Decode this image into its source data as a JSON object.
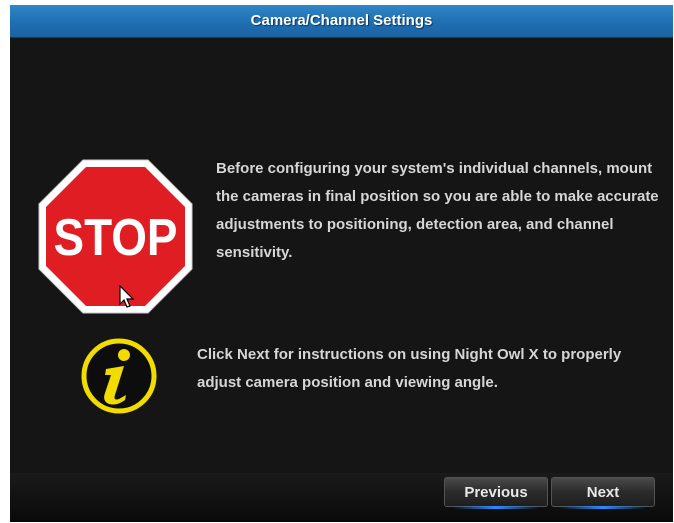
{
  "window": {
    "title": "Camera/Channel Settings"
  },
  "stop_sign": {
    "text": "STOP",
    "color": "#e11d24"
  },
  "messages": {
    "configure_warning": "Before configuring your system's individual channels, mount the cameras in final position so you are able to make accurate adjustments to positioning, detection area, and channel sensitivity.",
    "next_hint": "Click Next for instructions on using Night Owl X to properly adjust camera position and viewing angle."
  },
  "buttons": {
    "previous": "Previous",
    "next": "Next"
  },
  "colors": {
    "title_bar": "#1f6fb2",
    "info_icon": "#f2dc00",
    "button_glow": "#2a8cff"
  }
}
